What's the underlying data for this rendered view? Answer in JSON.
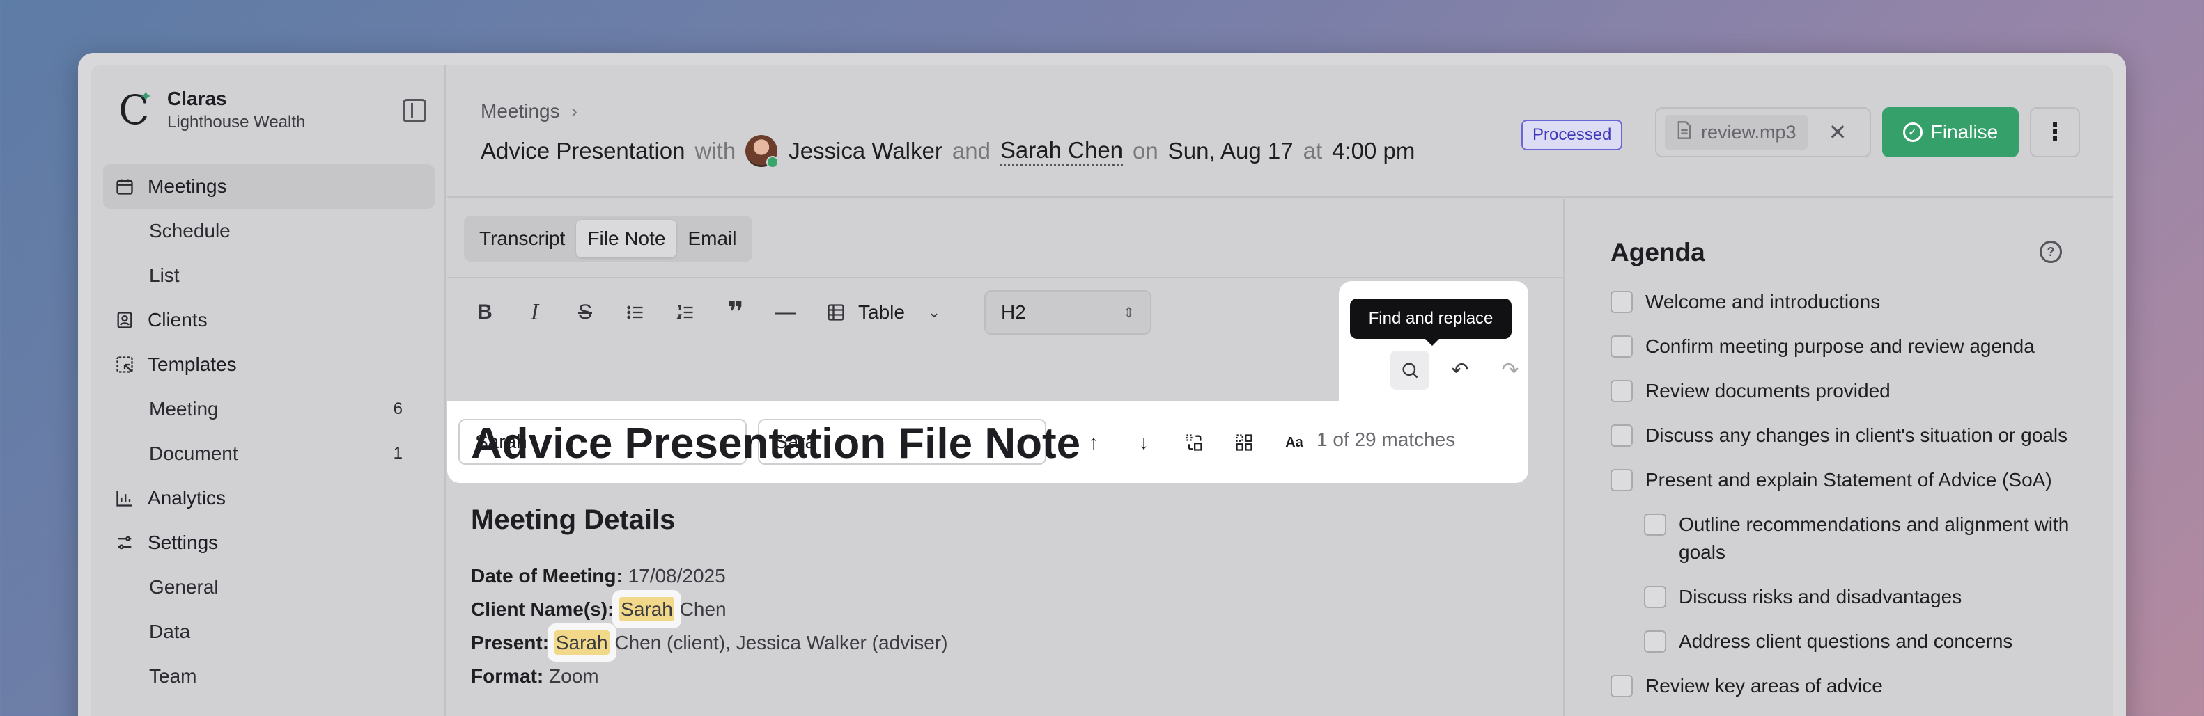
{
  "brand": {
    "name": "Claras",
    "org": "Lighthouse Wealth"
  },
  "sidebar": {
    "items": [
      {
        "label": "Meetings",
        "icon": "calendar-icon",
        "active": true
      },
      {
        "label": "Schedule",
        "sub": true
      },
      {
        "label": "List",
        "sub": true
      },
      {
        "label": "Clients",
        "icon": "contact-icon"
      },
      {
        "label": "Templates",
        "icon": "template-icon"
      },
      {
        "label": "Meeting",
        "sub": true,
        "count": "6"
      },
      {
        "label": "Document",
        "sub": true,
        "count": "1"
      },
      {
        "label": "Analytics",
        "icon": "chart-icon"
      },
      {
        "label": "Settings",
        "icon": "sliders-icon"
      },
      {
        "label": "General",
        "sub": true
      },
      {
        "label": "Data",
        "sub": true
      },
      {
        "label": "Team",
        "sub": true
      }
    ]
  },
  "header": {
    "breadcrumb": "Meetings",
    "title": "Advice Presentation",
    "with_word": "with",
    "adviser": "Jessica Walker",
    "and_word": "and",
    "client": "Sarah Chen",
    "on_word": "on",
    "date": "Sun, Aug 17",
    "at_word": "at",
    "time": "4:00 pm",
    "status": "Processed",
    "file": "review.mp3",
    "finalise": "Finalise"
  },
  "tabs": [
    "Transcript",
    "File Note",
    "Email"
  ],
  "active_tab": "File Note",
  "toolbar": {
    "table_label": "Table",
    "heading_select": "H2"
  },
  "find": {
    "tooltip": "Find and replace",
    "find_value": "Sarah",
    "replace_value": "Sara",
    "count": "1 of 29 matches"
  },
  "doc": {
    "title": "Advice Presentation File Note",
    "section": "Meeting Details",
    "lines": [
      {
        "label": "Date of Meeting:",
        "pre": "",
        "match": "",
        "post": "17/08/2025"
      },
      {
        "label": "Client Name(s):",
        "pre": "",
        "match": "Sarah",
        "post": "Chen"
      },
      {
        "label": "Present:",
        "pre": "",
        "match": "Sarah",
        "post": "Chen (client), Jessica Walker (adviser)"
      },
      {
        "label": "Format:",
        "pre": "",
        "match": "",
        "post": "Zoom"
      }
    ]
  },
  "agenda": {
    "title": "Agenda",
    "items": [
      {
        "label": "Welcome and introductions"
      },
      {
        "label": "Confirm meeting purpose and review agenda"
      },
      {
        "label": "Review documents provided"
      },
      {
        "label": "Discuss any changes in client's situation or goals"
      },
      {
        "label": "Present and explain Statement of Advice (SoA)"
      },
      {
        "label": "Outline recommendations and alignment with goals",
        "sub": true
      },
      {
        "label": "Discuss risks and disadvantages",
        "sub": true
      },
      {
        "label": "Address client questions and concerns",
        "sub": true
      },
      {
        "label": "Review key areas of advice"
      }
    ]
  },
  "colors": {
    "accent_green": "#35a06a",
    "badge_purple": "#6b66d6",
    "highlight": "#f2d98a"
  }
}
